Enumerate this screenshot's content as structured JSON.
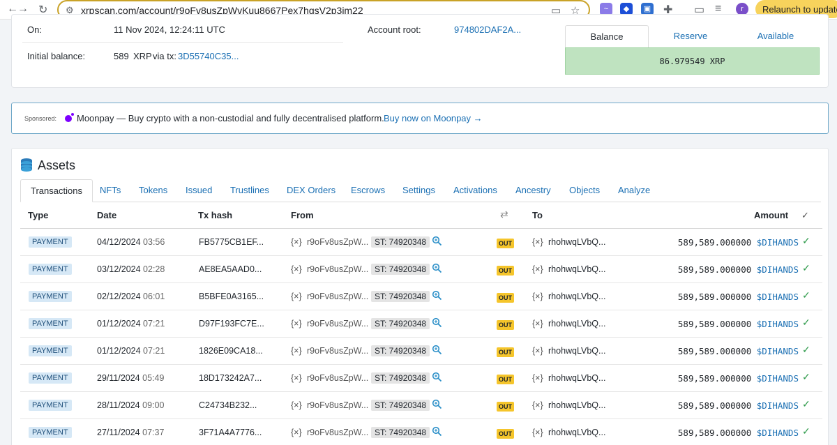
{
  "browser": {
    "url": "xrpscan.com/account/r9oFv8usZpWvKuu8667Pex7hgsV2p3im22",
    "relaunch_label": "Relaunch to update",
    "profile_initial": "r"
  },
  "account": {
    "on_label": "On:",
    "on_value": "11 Nov 2024, 12:24:11 UTC",
    "initial_balance_label": "Initial balance:",
    "initial_balance_value": "589",
    "initial_balance_unit": "XRP",
    "via_label": "via tx:",
    "via_tx": "3D55740C35...",
    "root_label": "Account root:",
    "root_value": "974802DAF2A..."
  },
  "balance": {
    "tabs": [
      "Balance",
      "Reserve",
      "Available"
    ],
    "value": "86.979549 XRP"
  },
  "sponsored": {
    "label": "Sponsored:",
    "text": "Moonpay — Buy crypto with a non-custodial and fully decentralised platform.",
    "link": "Buy now on Moonpay →"
  },
  "assets": {
    "title": "Assets",
    "tabs": [
      "Transactions",
      "NFTs",
      "Tokens",
      "Issued",
      "Trustlines",
      "DEX Orders",
      "Escrows",
      "Settings",
      "Activations",
      "Ancestry",
      "Objects",
      "Analyze"
    ],
    "headers": {
      "type": "Type",
      "date": "Date",
      "tx_hash": "Tx hash",
      "from": "From",
      "to": "To",
      "amount": "Amount"
    },
    "rows": [
      {
        "type": "PAYMENT",
        "date": "04/12/2024",
        "time": "03:56",
        "hash": "FB5775CB1EF...",
        "from": "r9oFv8usZpW...",
        "st": "ST: 74920348",
        "dir": "OUT",
        "to": "rhohwqLVbQ...",
        "amount": "589,589.000000",
        "currency": "$DIHANDS"
      },
      {
        "type": "PAYMENT",
        "date": "03/12/2024",
        "time": "02:28",
        "hash": "AE8EA5AAD0...",
        "from": "r9oFv8usZpW...",
        "st": "ST: 74920348",
        "dir": "OUT",
        "to": "rhohwqLVbQ...",
        "amount": "589,589.000000",
        "currency": "$DIHANDS"
      },
      {
        "type": "PAYMENT",
        "date": "02/12/2024",
        "time": "06:01",
        "hash": "B5BFE0A3165...",
        "from": "r9oFv8usZpW...",
        "st": "ST: 74920348",
        "dir": "OUT",
        "to": "rhohwqLVbQ...",
        "amount": "589,589.000000",
        "currency": "$DIHANDS"
      },
      {
        "type": "PAYMENT",
        "date": "01/12/2024",
        "time": "07:21",
        "hash": "D97F193FC7E...",
        "from": "r9oFv8usZpW...",
        "st": "ST: 74920348",
        "dir": "OUT",
        "to": "rhohwqLVbQ...",
        "amount": "589,589.000000",
        "currency": "$DIHANDS"
      },
      {
        "type": "PAYMENT",
        "date": "01/12/2024",
        "time": "07:21",
        "hash": "1826E09CA18...",
        "from": "r9oFv8usZpW...",
        "st": "ST: 74920348",
        "dir": "OUT",
        "to": "rhohwqLVbQ...",
        "amount": "589,589.000000",
        "currency": "$DIHANDS"
      },
      {
        "type": "PAYMENT",
        "date": "29/11/2024",
        "time": "05:49",
        "hash": "18D173242A7...",
        "from": "r9oFv8usZpW...",
        "st": "ST: 74920348",
        "dir": "OUT",
        "to": "rhohwqLVbQ...",
        "amount": "589,589.000000",
        "currency": "$DIHANDS"
      },
      {
        "type": "PAYMENT",
        "date": "28/11/2024",
        "time": "09:00",
        "hash": "C24734B232...",
        "from": "r9oFv8usZpW...",
        "st": "ST: 74920348",
        "dir": "OUT",
        "to": "rhohwqLVbQ...",
        "amount": "589,589.000000",
        "currency": "$DIHANDS"
      },
      {
        "type": "PAYMENT",
        "date": "27/11/2024",
        "time": "07:37",
        "hash": "3F71A4A7776...",
        "from": "r9oFv8usZpW...",
        "st": "ST: 74920348",
        "dir": "OUT",
        "to": "rhohwqLVbQ...",
        "amount": "589,589.000000",
        "currency": "$DIHANDS"
      }
    ]
  }
}
